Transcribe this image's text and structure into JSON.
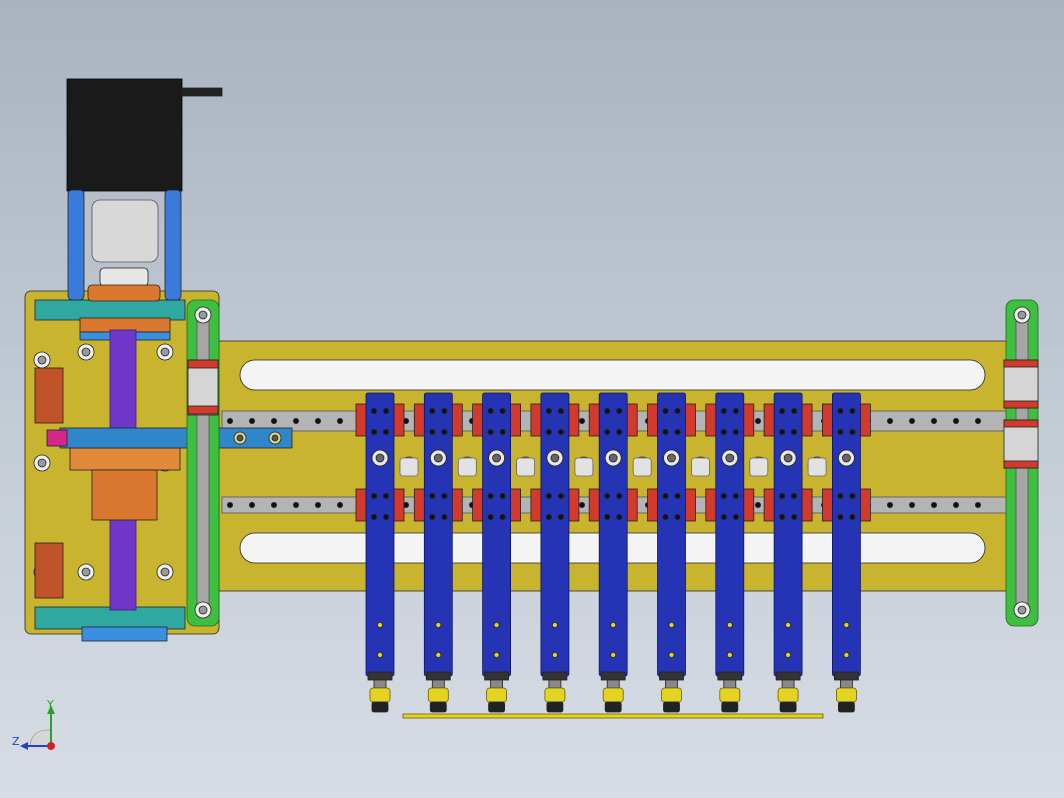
{
  "triad": {
    "y_label": "Y",
    "z_label": "Z"
  },
  "colors": {
    "frame": "#c9b42f",
    "frame_dark": "#8a7a10",
    "rail": "#b4b4b4",
    "rail_green": "#3fbf3f",
    "carriage_red": "#d23b2b",
    "arm_blue": "#2434b4",
    "nozzle_yellow": "#e2d421",
    "motor_black": "#1a1a1a",
    "screw_purple": "#6f37c8",
    "copper": "#d9782e",
    "teal": "#2fa8a2",
    "magenta": "#d4278a"
  },
  "picker": {
    "head_count": 9
  }
}
